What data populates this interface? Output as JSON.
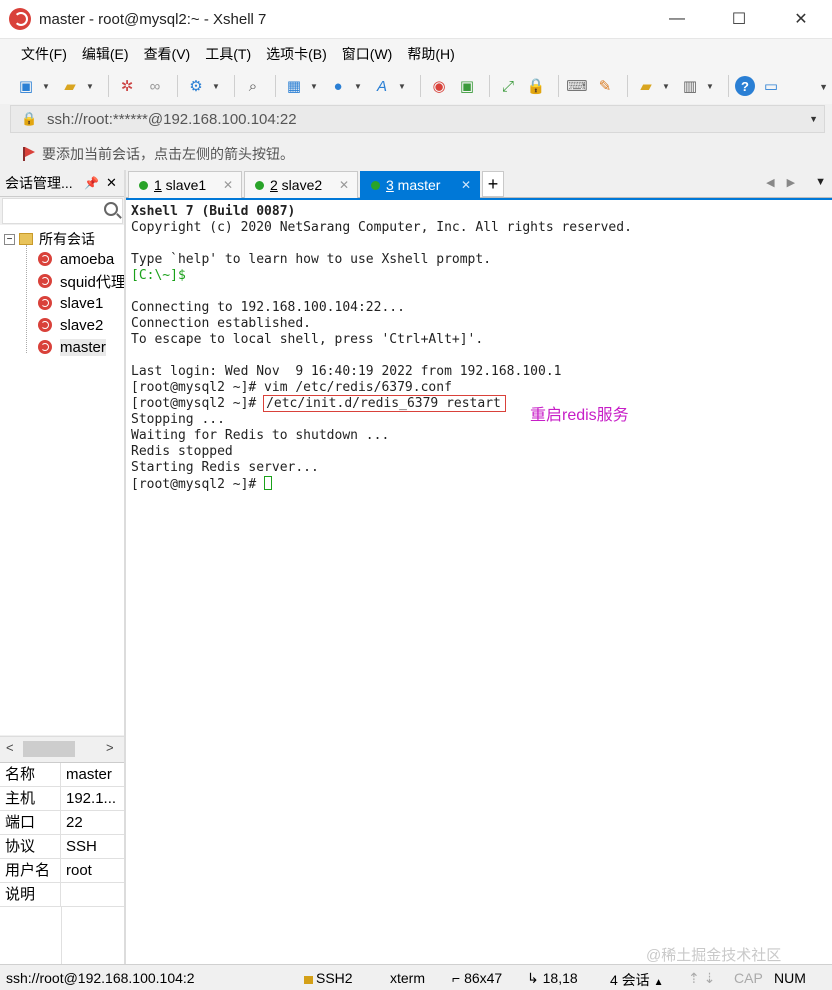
{
  "window": {
    "title": "master - root@mysql2:~ - Xshell 7",
    "minimize": "—",
    "maximize": "☐",
    "close": "✕"
  },
  "menu": [
    "文件(F)",
    "编辑(E)",
    "查看(V)",
    "工具(T)",
    "选项卡(B)",
    "窗口(W)",
    "帮助(H)"
  ],
  "address": {
    "value": "ssh://root:******@192.168.100.104:22"
  },
  "hint": "要添加当前会话，点击左侧的箭头按钮。",
  "session_panel": {
    "title": "会话管理...",
    "pin": "📌",
    "close": "✕",
    "root": "所有会话",
    "items": [
      "amoeba",
      "squid代理",
      "slave1",
      "slave2",
      "master"
    ],
    "properties": [
      {
        "key": "名称",
        "value": "master"
      },
      {
        "key": "主机",
        "value": "192.1..."
      },
      {
        "key": "端口",
        "value": "22"
      },
      {
        "key": "协议",
        "value": "SSH"
      },
      {
        "key": "用户名",
        "value": "root"
      },
      {
        "key": "说明",
        "value": ""
      }
    ]
  },
  "tabs": [
    {
      "num": "1",
      "label": " slave1"
    },
    {
      "num": "2",
      "label": " slave2"
    },
    {
      "num": "3",
      "label": " master"
    }
  ],
  "terminal": {
    "lines": [
      "Xshell 7 (Build 0087)",
      "Copyright (c) 2020 NetSarang Computer, Inc. All rights reserved.",
      "",
      "Type `help' to learn how to use Xshell prompt.",
      "[C:\\~]$",
      "",
      "Connecting to 192.168.100.104:22...",
      "Connection established.",
      "To escape to local shell, press 'Ctrl+Alt+]'.",
      "",
      "Last login: Wed Nov  9 16:40:19 2022 from 192.168.100.1",
      "[root@mysql2 ~]# vim /etc/redis/6379.conf",
      "[root@mysql2 ~]# ",
      "/etc/init.d/redis_6379 restart",
      "Stopping ...",
      "Waiting for Redis to shutdown ...",
      "Redis stopped",
      "Starting Redis server...",
      "[root@mysql2 ~]# "
    ],
    "annotation": "重启redis服务",
    "watermark": "@稀土掘金技术社区"
  },
  "status": {
    "conn": "ssh://root@192.168.100.104:2",
    "protocol": "SSH2",
    "term": "xterm",
    "size": "86x47",
    "pos": "18,18",
    "sessions": "4 会话",
    "cap": "CAP",
    "num": "NUM"
  },
  "colors": {
    "accent": "#0078d7",
    "prompt_green": "#1aa11a",
    "annotation": "#c71ec7",
    "highlight_box": "#d9413a"
  }
}
